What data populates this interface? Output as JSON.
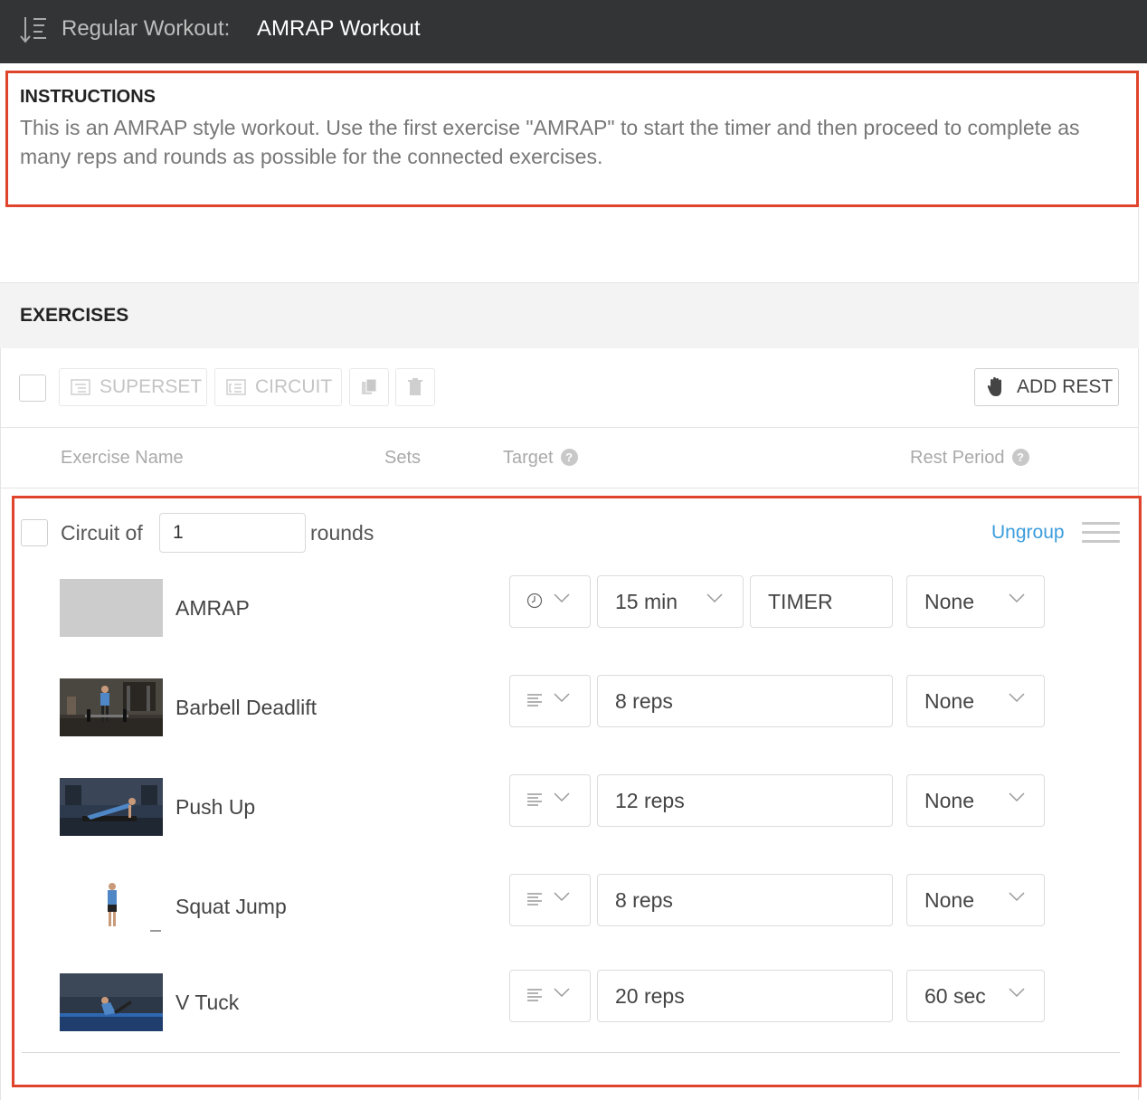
{
  "header": {
    "label": "Regular Workout:",
    "title": "AMRAP Workout",
    "icon": "sort-list-icon"
  },
  "instructions": {
    "heading": "INSTRUCTIONS",
    "text": "This is an AMRAP style workout. Use the first exercise \"AMRAP\" to start the timer and then proceed to complete as many reps and rounds as possible for the connected exercises."
  },
  "exercises": {
    "title": "EXERCISES",
    "toolbar": {
      "superset_label": "SUPERSET",
      "circuit_label": "CIRCUIT",
      "add_rest_label": "ADD REST"
    },
    "columns": {
      "name": "Exercise Name",
      "sets": "Sets",
      "target": "Target",
      "rest": "Rest Period"
    },
    "circuit": {
      "prefix": "Circuit of",
      "rounds_value": "1",
      "suffix": "rounds",
      "ungroup_label": "Ungroup"
    },
    "rows": [
      {
        "name": "AMRAP",
        "set_icon": "clock-icon",
        "target": "15 min",
        "target_dropdown": true,
        "timer": "TIMER",
        "rest": "None"
      },
      {
        "name": "Barbell Deadlift",
        "set_icon": "lines-icon",
        "target": "8 reps",
        "rest": "None"
      },
      {
        "name": "Push Up",
        "set_icon": "lines-icon",
        "target": "12 reps",
        "rest": "None"
      },
      {
        "name": "Squat Jump",
        "set_icon": "lines-icon",
        "target": "8 reps",
        "rest": "None"
      },
      {
        "name": "V Tuck",
        "set_icon": "lines-icon",
        "target": "20 reps",
        "rest": "60 sec"
      }
    ]
  },
  "colors": {
    "header_bg": "#333435",
    "highlight_border": "#e0442c",
    "link": "#3b9ddd"
  }
}
